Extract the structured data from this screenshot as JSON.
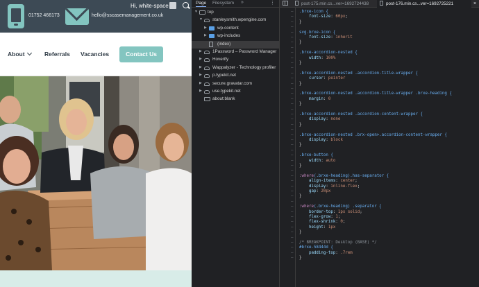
{
  "website": {
    "phone": "01752 466173",
    "email": "hello@sscasemanagement.co.uk",
    "admin_greeting": "Hi, white-space",
    "nav": {
      "about": "About",
      "referrals": "Referrals",
      "vacancies": "Vacancies",
      "contact": "Contact Us"
    },
    "accent_color": "#83c5c0",
    "topbar_color": "#3d4a55"
  },
  "devtools": {
    "tabs": [
      "Page",
      "Filesystem"
    ],
    "more": "»",
    "tree": [
      {
        "label": "top",
        "icon": "frame-icon",
        "twisty": "▼"
      },
      {
        "label": "stanleysmith.wpengine.com",
        "icon": "cloud-icon",
        "twisty": "▼"
      },
      {
        "label": "wp-content",
        "icon": "folder-icon",
        "twisty": "▶"
      },
      {
        "label": "wp-includes",
        "icon": "folder-icon",
        "twisty": "▶"
      },
      {
        "label": "(index)",
        "icon": "file-icon",
        "twisty": ""
      },
      {
        "label": "1Password – Password Manager",
        "icon": "cloud-icon",
        "twisty": "▶"
      },
      {
        "label": "Hoverify",
        "icon": "cloud-icon",
        "twisty": "▶"
      },
      {
        "label": "Wappalyzer - Technology profiler",
        "icon": "cloud-icon",
        "twisty": "▶"
      },
      {
        "label": "p.typekit.net",
        "icon": "cloud-icon",
        "twisty": "▶"
      },
      {
        "label": "secure.gravatar.com",
        "icon": "cloud-icon",
        "twisty": "▶"
      },
      {
        "label": "use.typekit.net",
        "icon": "cloud-icon",
        "twisty": "▶"
      },
      {
        "label": "about:blank",
        "icon": "frame-icon",
        "twisty": ""
      }
    ],
    "editor_tabs": [
      {
        "label": "post-175.min.cs...ver=1692724438"
      },
      {
        "label": "post-176.min.cs...ver=1692725221",
        "close": "×"
      }
    ],
    "code_lines": [
      {
        "parts": [
          {
            "t": ".brxe-icon {",
            "c": "sel"
          }
        ]
      },
      {
        "parts": [
          {
            "t": "    font-size",
            "c": "prop"
          },
          {
            "t": ": ",
            "c": ""
          },
          {
            "t": "60px",
            "c": "val"
          },
          {
            "t": ";",
            "c": ""
          }
        ]
      },
      {
        "parts": [
          {
            "t": "}",
            "c": ""
          }
        ]
      },
      {
        "parts": []
      },
      {
        "parts": [
          {
            "t": "svg.brxe-icon {",
            "c": "sel"
          }
        ]
      },
      {
        "parts": [
          {
            "t": "    font-size",
            "c": "prop"
          },
          {
            "t": ": ",
            "c": ""
          },
          {
            "t": "inherit",
            "c": "val"
          }
        ]
      },
      {
        "parts": [
          {
            "t": "}",
            "c": ""
          }
        ]
      },
      {
        "parts": []
      },
      {
        "parts": [
          {
            "t": ".brxe-accordion-nested {",
            "c": "sel"
          }
        ]
      },
      {
        "parts": [
          {
            "t": "    width",
            "c": "prop"
          },
          {
            "t": ": ",
            "c": ""
          },
          {
            "t": "100%",
            "c": "val"
          }
        ]
      },
      {
        "parts": [
          {
            "t": "}",
            "c": ""
          }
        ]
      },
      {
        "parts": []
      },
      {
        "parts": [
          {
            "t": ".brxe-accordion-nested .accordion-title-wrapper {",
            "c": "sel"
          }
        ]
      },
      {
        "parts": [
          {
            "t": "    cursor",
            "c": "prop"
          },
          {
            "t": ": ",
            "c": ""
          },
          {
            "t": "pointer",
            "c": "val"
          }
        ]
      },
      {
        "parts": [
          {
            "t": "}",
            "c": ""
          }
        ]
      },
      {
        "parts": []
      },
      {
        "parts": [
          {
            "t": ".brxe-accordion-nested .accordion-title-wrapper .brxe-heading {",
            "c": "sel"
          }
        ]
      },
      {
        "parts": [
          {
            "t": "    margin",
            "c": "prop"
          },
          {
            "t": ": ",
            "c": ""
          },
          {
            "t": "0",
            "c": "val"
          }
        ]
      },
      {
        "parts": [
          {
            "t": "}",
            "c": ""
          }
        ]
      },
      {
        "parts": []
      },
      {
        "parts": [
          {
            "t": ".brxe-accordion-nested .accordion-content-wrapper {",
            "c": "sel"
          }
        ]
      },
      {
        "parts": [
          {
            "t": "    display",
            "c": "prop"
          },
          {
            "t": ": ",
            "c": ""
          },
          {
            "t": "none",
            "c": "val"
          }
        ]
      },
      {
        "parts": [
          {
            "t": "}",
            "c": ""
          }
        ]
      },
      {
        "parts": []
      },
      {
        "parts": [
          {
            "t": ".brxe-accordion-nested .brx-open>.accordion-content-wrapper {",
            "c": "sel"
          }
        ]
      },
      {
        "parts": [
          {
            "t": "    display",
            "c": "prop"
          },
          {
            "t": ": ",
            "c": ""
          },
          {
            "t": "block",
            "c": "val"
          }
        ]
      },
      {
        "parts": [
          {
            "t": "}",
            "c": ""
          }
        ]
      },
      {
        "parts": []
      },
      {
        "parts": [
          {
            "t": ".brxe-button {",
            "c": "sel"
          }
        ]
      },
      {
        "parts": [
          {
            "t": "    width",
            "c": "prop"
          },
          {
            "t": ": ",
            "c": ""
          },
          {
            "t": "auto",
            "c": "val"
          }
        ]
      },
      {
        "parts": [
          {
            "t": "}",
            "c": ""
          }
        ]
      },
      {
        "parts": []
      },
      {
        "parts": [
          {
            "t": ":where",
            "c": "pseudo"
          },
          {
            "t": "(.brxe-heading).has-separator {",
            "c": "sel"
          }
        ]
      },
      {
        "parts": [
          {
            "t": "    align-items",
            "c": "prop"
          },
          {
            "t": ": ",
            "c": ""
          },
          {
            "t": "center",
            "c": "val"
          },
          {
            "t": ";",
            "c": ""
          }
        ]
      },
      {
        "parts": [
          {
            "t": "    display",
            "c": "prop"
          },
          {
            "t": ": ",
            "c": ""
          },
          {
            "t": "inline-flex",
            "c": "val"
          },
          {
            "t": ";",
            "c": ""
          }
        ]
      },
      {
        "parts": [
          {
            "t": "    gap",
            "c": "prop"
          },
          {
            "t": ": ",
            "c": ""
          },
          {
            "t": "20px",
            "c": "val"
          }
        ]
      },
      {
        "parts": [
          {
            "t": "}",
            "c": ""
          }
        ]
      },
      {
        "parts": []
      },
      {
        "parts": [
          {
            "t": ":where",
            "c": "pseudo"
          },
          {
            "t": "(.brxe-heading) .separator {",
            "c": "sel"
          }
        ]
      },
      {
        "parts": [
          {
            "t": "    border-top",
            "c": "prop"
          },
          {
            "t": ": ",
            "c": ""
          },
          {
            "t": "1px solid",
            "c": "val"
          },
          {
            "t": ";",
            "c": ""
          }
        ]
      },
      {
        "parts": [
          {
            "t": "    flex-grow",
            "c": "prop"
          },
          {
            "t": ": ",
            "c": ""
          },
          {
            "t": "1",
            "c": "val"
          },
          {
            "t": ";",
            "c": ""
          }
        ]
      },
      {
        "parts": [
          {
            "t": "    flex-shrink",
            "c": "prop"
          },
          {
            "t": ": ",
            "c": ""
          },
          {
            "t": "0",
            "c": "val"
          },
          {
            "t": ";",
            "c": ""
          }
        ]
      },
      {
        "parts": [
          {
            "t": "    height",
            "c": "prop"
          },
          {
            "t": ": ",
            "c": ""
          },
          {
            "t": "1px",
            "c": "val"
          }
        ]
      },
      {
        "parts": [
          {
            "t": "}",
            "c": ""
          }
        ]
      },
      {
        "parts": []
      },
      {
        "parts": [
          {
            "t": "/* BREAKPOINT: Desktop (BASE) */",
            "c": "cmt"
          }
        ]
      },
      {
        "parts": [
          {
            "t": "#brxe-58444d {",
            "c": "sel"
          }
        ]
      },
      {
        "parts": [
          {
            "t": "    padding-top",
            "c": "prop"
          },
          {
            "t": ": ",
            "c": ""
          },
          {
            "t": ".7rem",
            "c": "val"
          }
        ]
      },
      {
        "parts": [
          {
            "t": "}",
            "c": ""
          }
        ]
      }
    ]
  }
}
